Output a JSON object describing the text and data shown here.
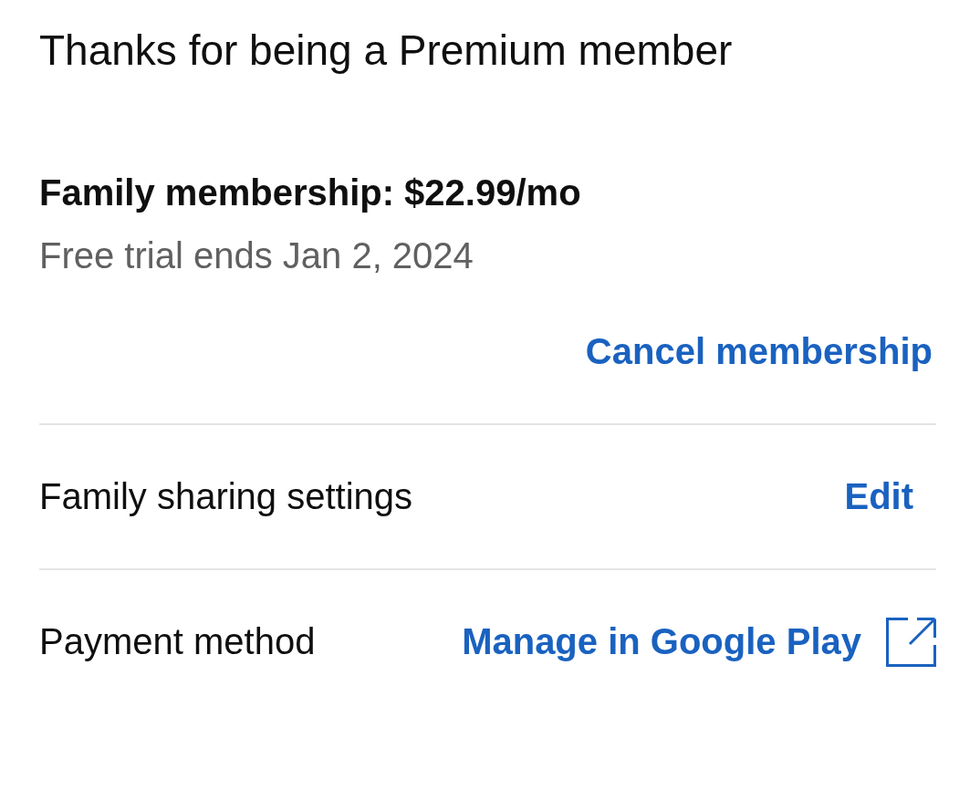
{
  "header": {
    "title": "Thanks for being a Premium member"
  },
  "membership": {
    "plan": "Family membership: $22.99/mo",
    "trial_note": "Free trial ends Jan 2, 2024",
    "cancel_link": "Cancel membership"
  },
  "settings_rows": [
    {
      "label": "Family sharing settings",
      "action": "Edit",
      "external": false
    },
    {
      "label": "Payment method",
      "action": "Manage in Google Play",
      "external": true
    }
  ]
}
